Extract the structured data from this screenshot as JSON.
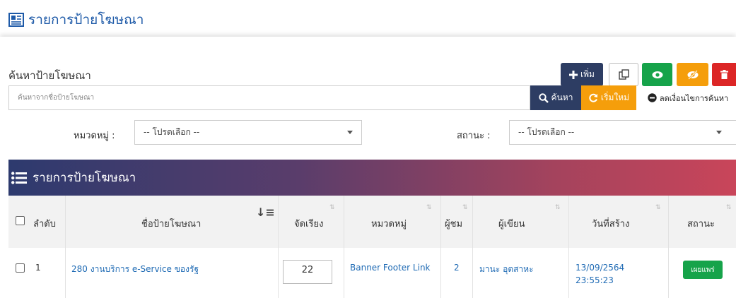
{
  "page": {
    "title": "รายการป้ายโฆษณา"
  },
  "panel": {
    "title": "ค้นหาป้ายโฆษณา"
  },
  "toolbar": {
    "add_label": "เพิ่ม"
  },
  "search": {
    "placeholder": "ค้นหาจากชื่อป้ายโฆษณา",
    "search_label": "ค้นหา",
    "reset_label": "เริ่มใหม่",
    "less_label": "ลดเงื่อนไขการค้นหา"
  },
  "filters": {
    "category_label": "หมวดหมู่ :",
    "category_value": "-- โปรดเลือก --",
    "status_label": "สถานะ :",
    "status_value": "-- โปรดเลือก --"
  },
  "list": {
    "title": "รายการป้ายโฆษณา",
    "columns": [
      "ลำดับ",
      "ชื่อป้ายโฆษณา",
      "จัดเรียง",
      "หมวดหมู่",
      "ผู้ชม",
      "ผู้เขียน",
      "วันที่สร้าง",
      "สถานะ"
    ],
    "rows": [
      {
        "no": "1",
        "name": "280 งานบริการ e-Service ของรัฐ",
        "order": "22",
        "category": "Banner Footer Link",
        "views": "2",
        "author": "มานะ อุตสาหะ",
        "created_date": "13/09/2564",
        "created_time": "23:55:23",
        "status": "เผยแพร่"
      }
    ]
  },
  "colors": {
    "navy": "#2d3d63",
    "green": "#16a34a",
    "orange": "#f59e0b",
    "red": "#dc2626",
    "link": "#1e6ab4",
    "title_blue": "#1e5aa8"
  }
}
